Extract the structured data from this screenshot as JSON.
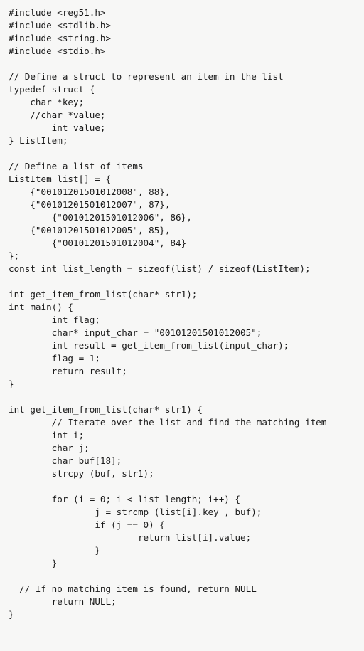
{
  "document": {
    "kind": "source-code-listing",
    "language": "C",
    "background_color": "#f7f7f6",
    "text_color": "#1b1b1b",
    "lines": [
      "#include <reg51.h>",
      "#include <stdlib.h>",
      "#include <string.h>",
      "#include <stdio.h>",
      "",
      "// Define a struct to represent an item in the list",
      "typedef struct {",
      "    char *key;",
      "    //char *value;",
      "        int value;",
      "} ListItem;",
      "",
      "// Define a list of items",
      "ListItem list[] = {",
      "    {\"00101201501012008\", 88},",
      "    {\"00101201501012007\", 87},",
      "        {\"00101201501012006\", 86},",
      "    {\"00101201501012005\", 85},",
      "        {\"00101201501012004\", 84}",
      "};",
      "const int list_length = sizeof(list) / sizeof(ListItem);",
      "",
      "int get_item_from_list(char* str1);",
      "int main() {",
      "        int flag;",
      "        char* input_char = \"00101201501012005\";",
      "        int result = get_item_from_list(input_char);",
      "        flag = 1;",
      "        return result;",
      "}",
      "",
      "int get_item_from_list(char* str1) {",
      "        // Iterate over the list and find the matching item",
      "        int i;",
      "        char j;",
      "        char buf[18];",
      "        strcpy (buf, str1);",
      "",
      "        for (i = 0; i < list_length; i++) {",
      "                j = strcmp (list[i].key , buf);",
      "                if (j == 0) {",
      "                        return list[i].value;",
      "                }",
      "        }",
      "",
      "  // If no matching item is found, return NULL",
      "        return NULL;",
      "}"
    ]
  }
}
